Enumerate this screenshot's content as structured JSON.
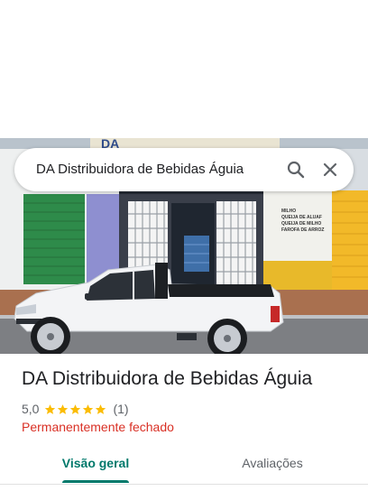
{
  "search": {
    "query": "DA Distribuidora de Bebidas Águia",
    "search_icon": "search-icon",
    "close_icon": "close-icon"
  },
  "photo": {
    "sign_text": "DA",
    "wall_notice_text": "MILHO QUEIJA DE ALUAF QUEIJA DE MILHO FAROFA DE ARROZ"
  },
  "place": {
    "name": "DA Distribuidora de Bebidas Águia",
    "rating": "5,0",
    "stars": 5,
    "review_count": "(1)",
    "status": "Permanentemente fechado"
  },
  "tabs": [
    {
      "label": "Visão geral",
      "active": true
    },
    {
      "label": "Avaliações",
      "active": false
    }
  ],
  "colors": {
    "accent": "#00796b",
    "closed_red": "#d93025",
    "star": "#fbbc04"
  }
}
